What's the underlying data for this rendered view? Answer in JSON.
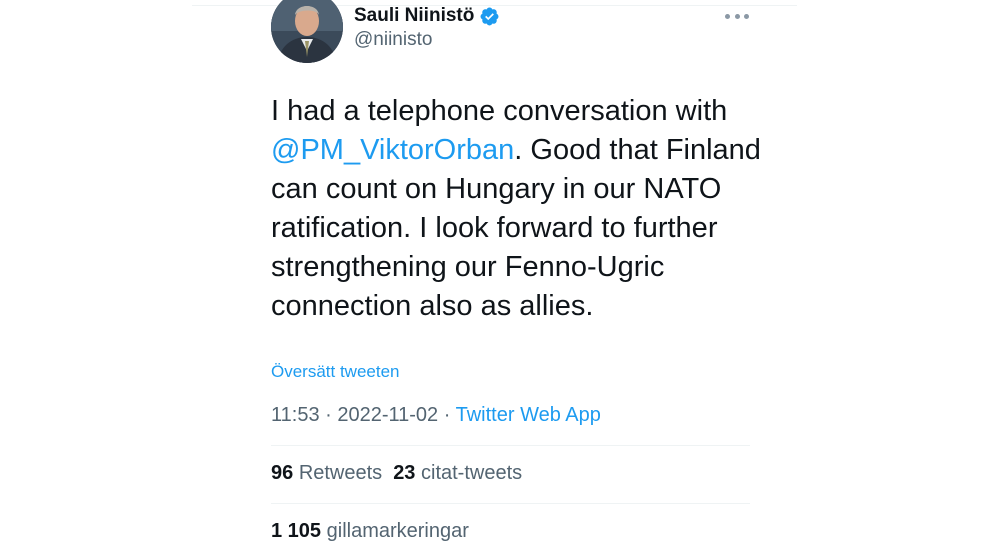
{
  "author": {
    "display_name": "Sauli Niinistö",
    "handle": "@niinisto",
    "verified": true
  },
  "tweet": {
    "text_part1": "I had a telephone conversation with ",
    "mention": "@PM_ViktorOrban",
    "text_part2": ". Good that Finland can count on Hungary in our NATO ratification. I look forward to further strengthening our Fenno-Ugric connection also as allies."
  },
  "translate_label": "Översätt tweeten",
  "meta": {
    "time": "11:53",
    "date": "2022-11-02",
    "source": "Twitter Web App"
  },
  "stats": {
    "retweets_count": "96",
    "retweets_label": "Retweets",
    "quotes_count": "23",
    "quotes_label": "citat-tweets",
    "likes_count": "1 105",
    "likes_label": "gillamarkeringar"
  },
  "icons": {
    "verified": "verified-badge-icon",
    "more": "more-options-icon"
  },
  "colors": {
    "link": "#1d9bf0",
    "text": "#0f1419",
    "secondary": "#536471"
  }
}
